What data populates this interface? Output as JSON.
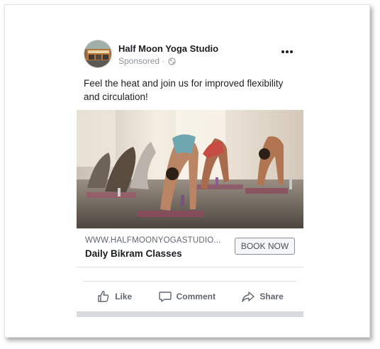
{
  "post": {
    "page_name": "Half Moon Yoga Studio",
    "sponsored_label": "Sponsored",
    "separator": "·",
    "audience_icon": "globe-icon",
    "more_icon": "more-options-icon",
    "text": "Feel the heat and join us for improved flexibility\nand circulation!"
  },
  "link": {
    "domain": "WWW.HALFMOONYOGASTUDIO...",
    "headline": "Daily Bikram Classes",
    "cta_label": "BOOK NOW"
  },
  "actions": {
    "like_label": "Like",
    "comment_label": "Comment",
    "share_label": "Share"
  },
  "colors": {
    "text": "#1c1e21",
    "secondary": "#606770",
    "meta": "#90949c",
    "divider": "#dddfe2"
  }
}
